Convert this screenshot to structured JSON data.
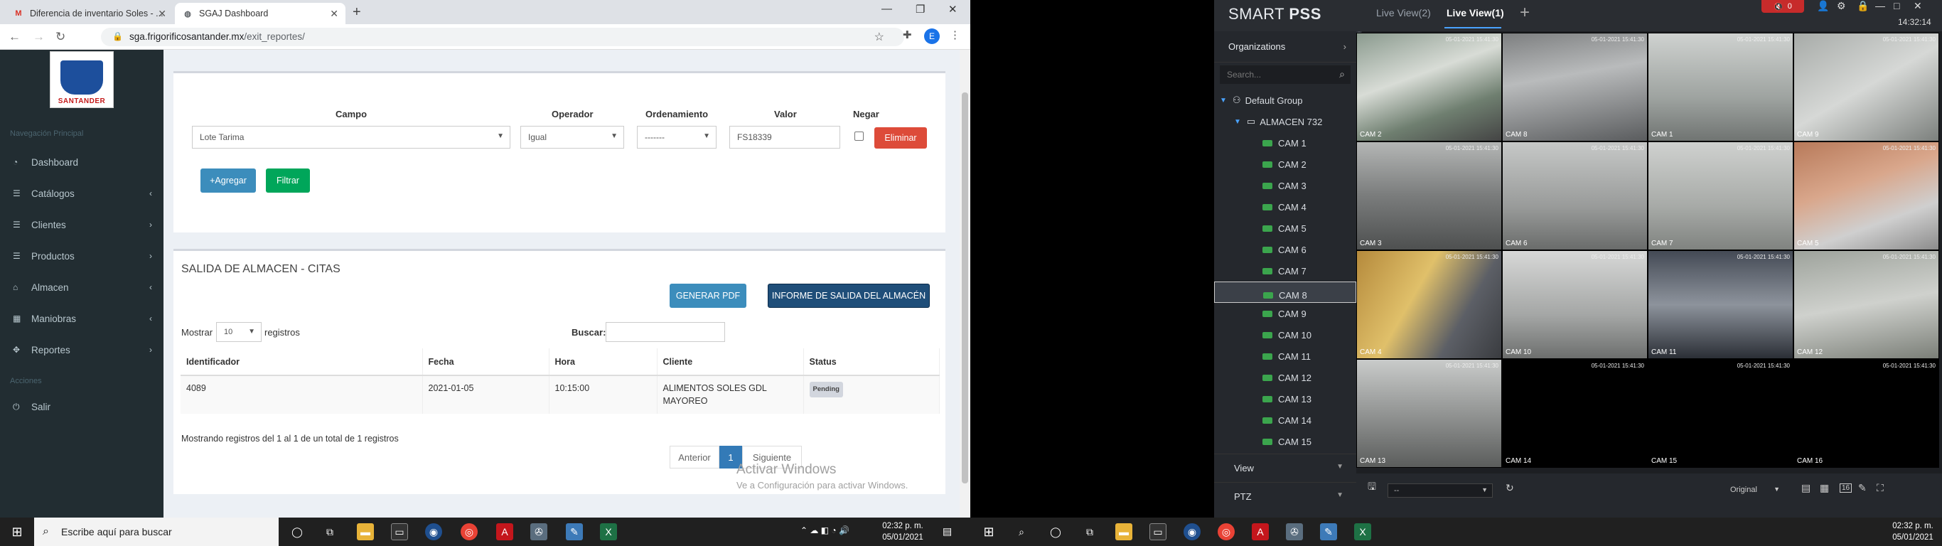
{
  "browser": {
    "tab1_title": "Diferencia de inventario Soles - ...",
    "tab2_title": "SGAJ Dashboard",
    "tab_close": "✕",
    "new_tab": "+",
    "url_domain": "sga.frigorificosantander.mx",
    "url_path": "/exit_reportes/",
    "avatar_letter": "E"
  },
  "sidebar": {
    "logo_text": "SANTANDER",
    "nav_header": "Navegación Principal",
    "items": [
      {
        "label": "Dashboard",
        "icon": "dashboard-icon",
        "arrow": ""
      },
      {
        "label": "Catálogos",
        "icon": "list-icon",
        "arrow": "‹"
      },
      {
        "label": "Clientes",
        "icon": "users-icon",
        "arrow": "›"
      },
      {
        "label": "Productos",
        "icon": "box-icon",
        "arrow": "›"
      },
      {
        "label": "Almacen",
        "icon": "warehouse-icon",
        "arrow": "‹"
      },
      {
        "label": "Maniobras",
        "icon": "grid-icon",
        "arrow": "‹"
      },
      {
        "label": "Reportes",
        "icon": "puzzle-icon",
        "arrow": "›"
      }
    ],
    "actions_header": "Acciones",
    "logout": "Salir"
  },
  "filter": {
    "headers": {
      "campo": "Campo",
      "operador": "Operador",
      "ordenamiento": "Ordenamiento",
      "valor": "Valor",
      "negar": "Negar"
    },
    "campo": "Lote Tarima",
    "operador": "Igual",
    "ordenamiento": "-------",
    "valor": "FS18339",
    "negar_checked": false,
    "delete_button": "Eliminar",
    "add_button": "+Agregar",
    "filter_button": "Filtrar"
  },
  "report": {
    "title": "SALIDA DE ALMACEN - CITAS",
    "pdf_button": "GENERAR PDF",
    "report_button": "INFORME DE SALIDA DEL ALMACÉN",
    "show_label": "Mostrar",
    "show_value": "10",
    "records_label": "registros",
    "search_label": "Buscar:",
    "columns": [
      "Identificador",
      "Fecha",
      "Hora",
      "Cliente",
      "Status"
    ],
    "rows": [
      {
        "id": "4089",
        "fecha": "2021-01-05",
        "hora": "10:15:00",
        "cliente": "ALIMENTOS SOLES GDL MAYOREO",
        "status": "Pending"
      }
    ],
    "info": "Mostrando registros del 1 al 1 de un total de 1 registros",
    "prev": "Anterior",
    "page": "1",
    "next": "Siguiente"
  },
  "watermark": {
    "title": "Activar Windows",
    "subtitle": "Ve a Configuración para activar Windows."
  },
  "taskbar": {
    "search_placeholder": "Escribe aquí para buscar",
    "time": "02:32 p. m.",
    "date": "05/01/2021"
  },
  "pss": {
    "logo_a": "SMART",
    "logo_b": "PSS",
    "tab1": "Live View(2)",
    "tab2": "Live View(1)",
    "alarm_count": "0",
    "time": "14:32:14",
    "organizations": "Organizations",
    "search_placeholder": "Search...",
    "group": "Default Group",
    "device": "ALMACEN 732",
    "cameras": [
      "CAM 1",
      "CAM 2",
      "CAM 3",
      "CAM 4",
      "CAM 5",
      "CAM 6",
      "CAM 7",
      "CAM 8",
      "CAM 9",
      "CAM 10",
      "CAM 11",
      "CAM 12",
      "CAM 13",
      "CAM 14",
      "CAM 15"
    ],
    "selected_camera": "CAM 8",
    "view_label": "View",
    "ptz_label": "PTZ",
    "grid_labels": [
      "CAM 2",
      "CAM 8",
      "CAM 1",
      "CAM 9",
      "CAM 3",
      "CAM 6",
      "CAM 7",
      "CAM 5",
      "CAM 4",
      "CAM 10",
      "CAM 11",
      "CAM 12",
      "CAM 13",
      "CAM 14",
      "CAM 15",
      "CAM 16"
    ],
    "timestamp": "05-01-2021 15:41:30",
    "preset_select": "--",
    "original_select": "Original",
    "layout_16": "16"
  }
}
